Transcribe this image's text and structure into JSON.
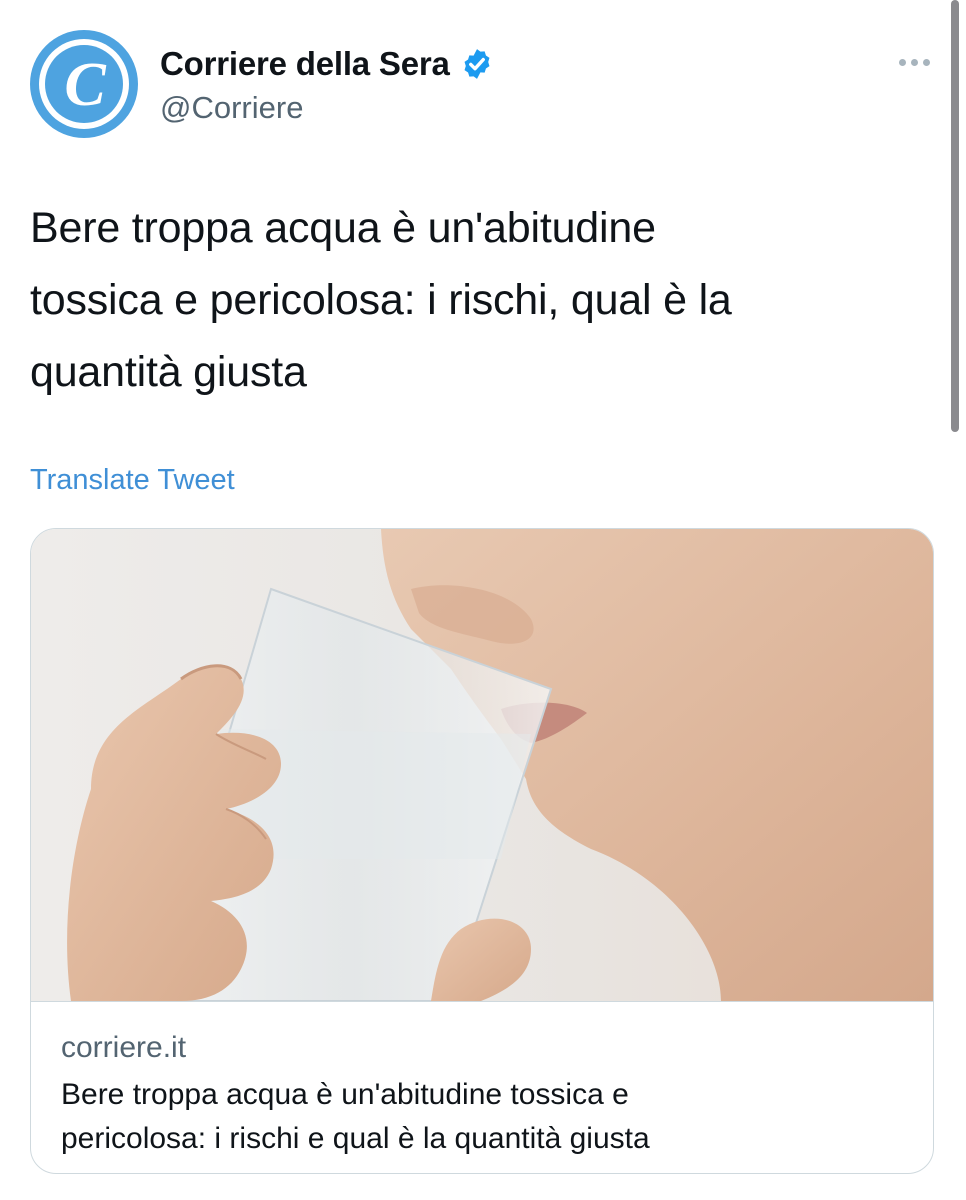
{
  "author": {
    "display_name": "Corriere della Sera",
    "handle": "@Corriere",
    "verified": true,
    "avatar_letter": "C",
    "avatar_color": "#4ea3e0"
  },
  "tweet": {
    "text_lines": [
      "Bere troppa acqua è un'abitudine",
      "tossica e pericolosa: i rischi, qual è la",
      "quantità giusta"
    ],
    "translate_label": "Translate Tweet"
  },
  "link_card": {
    "domain": "corriere.it",
    "title_lines": [
      "Bere troppa acqua è un'abitudine tossica e",
      "pericolosa: i rischi e qual è la quantità giusta"
    ]
  },
  "colors": {
    "link_blue": "#3f8fd6",
    "verified_blue": "#1d9bf0",
    "secondary_text": "#536471"
  }
}
